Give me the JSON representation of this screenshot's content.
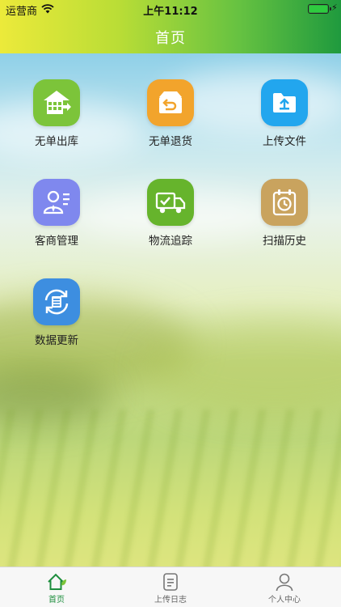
{
  "status_bar": {
    "carrier": "运营商",
    "time": "上午11:12"
  },
  "nav": {
    "title": "首页"
  },
  "tiles": [
    {
      "label": "无单出库",
      "icon": "warehouse-outbound-icon",
      "color": "#7cc43a"
    },
    {
      "label": "无单退货",
      "icon": "return-box-icon",
      "color": "#f2a42c"
    },
    {
      "label": "上传文件",
      "icon": "upload-folder-icon",
      "color": "#22a6ee"
    },
    {
      "label": "客商管理",
      "icon": "client-card-icon",
      "color": "#7f88ee"
    },
    {
      "label": "物流追踪",
      "icon": "delivery-truck-icon",
      "color": "#66b42c"
    },
    {
      "label": "扫描历史",
      "icon": "history-clock-icon",
      "color": "#c9a35e"
    },
    {
      "label": "数据更新",
      "icon": "data-sync-icon",
      "color": "#3d8ee0"
    }
  ],
  "tabbar": {
    "items": [
      {
        "label": "首页",
        "icon": "home-icon",
        "active": true
      },
      {
        "label": "上传日志",
        "icon": "log-document-icon",
        "active": false
      },
      {
        "label": "个人中心",
        "icon": "person-icon",
        "active": false
      }
    ],
    "active_color": "#1e8e3e"
  }
}
